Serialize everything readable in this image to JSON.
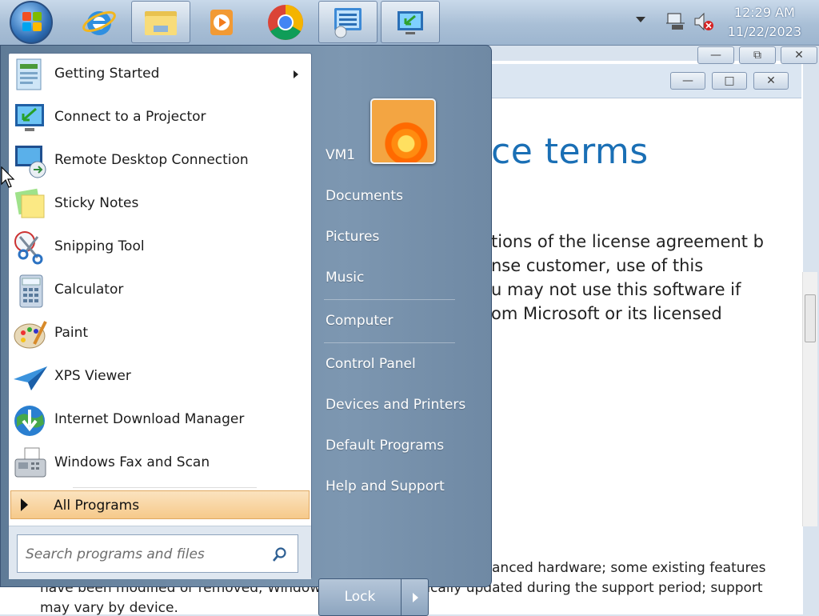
{
  "taskbar": {
    "pinned": [
      {
        "name": "start-orb"
      },
      {
        "name": "internet-explorer-icon"
      },
      {
        "name": "file-explorer-icon"
      },
      {
        "name": "media-player-icon"
      },
      {
        "name": "chrome-icon"
      },
      {
        "name": "control-panel-icon"
      },
      {
        "name": "projector-icon"
      }
    ],
    "clock": {
      "time": "12:29 AM",
      "date": "11/22/2023"
    }
  },
  "background_window": {
    "heading": "ce terms",
    "paragraph_lines": [
      "tions of the license agreement by",
      "nse customer, use of this",
      "u may not use this software if",
      "om Microsoft or its licensed"
    ],
    "bottom_lines": [
      "anced hardware; some existing features",
      "have been modified or removed; Windows 10 is automatically updated during the support period; support",
      "may vary by device."
    ]
  },
  "start_menu": {
    "programs": [
      {
        "label": "Getting Started",
        "icon": "getting-started-icon",
        "submenu": true
      },
      {
        "label": "Connect to a Projector",
        "icon": "projector-icon"
      },
      {
        "label": "Remote Desktop Connection",
        "icon": "remote-desktop-icon"
      },
      {
        "label": "Sticky Notes",
        "icon": "sticky-notes-icon"
      },
      {
        "label": "Snipping Tool",
        "icon": "scissors-icon"
      },
      {
        "label": "Calculator",
        "icon": "calculator-icon"
      },
      {
        "label": "Paint",
        "icon": "paint-palette-icon"
      },
      {
        "label": "XPS Viewer",
        "icon": "xps-viewer-icon"
      },
      {
        "label": "Internet Download Manager",
        "icon": "idm-globe-icon"
      },
      {
        "label": "Windows Fax and Scan",
        "icon": "fax-icon"
      }
    ],
    "all_programs_label": "All Programs",
    "search_placeholder": "Search programs and files",
    "right_links": [
      "VM1",
      "Documents",
      "Pictures",
      "Music",
      "Computer",
      "Control Panel",
      "Devices and Printers",
      "Default Programs",
      "Help and Support"
    ],
    "lock_label": "Lock"
  }
}
